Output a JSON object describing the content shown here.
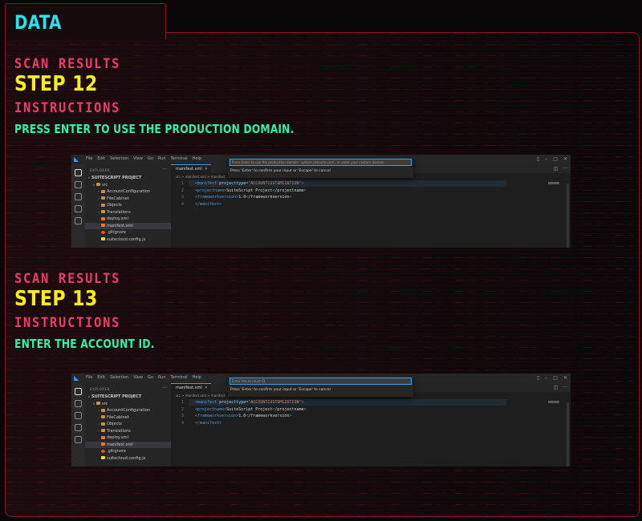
{
  "header": {
    "title": "DATA"
  },
  "steps": [
    {
      "scan_label": "SCAN RESULTS",
      "step": "STEP 12",
      "instructions_label": "INSTRUCTIONS",
      "instruction": "PRESS ENTER TO USE THE PRODUCTION DOMAIN.",
      "screenshot": {
        "menu": [
          "File",
          "Edit",
          "Selection",
          "View",
          "Go",
          "Run",
          "Terminal",
          "Help"
        ],
        "palette_input": "Press Enter to use the production domain 'system.netsuite.com', or enter your custom domain.",
        "palette_hint": "Press 'Enter' to confirm your input or 'Escape' to cancel",
        "explorer_label": "EXPLORER",
        "tree": [
          {
            "label": "SUITESCRIPT PROJECT",
            "kind": "root"
          },
          {
            "label": "src",
            "kind": "folder-open"
          },
          {
            "label": "AccountConfiguration",
            "kind": "folder"
          },
          {
            "label": "FileCabinet",
            "kind": "folder"
          },
          {
            "label": "Objects",
            "kind": "folder"
          },
          {
            "label": "Translations",
            "kind": "folder"
          },
          {
            "label": "deploy.xml",
            "kind": "xml"
          },
          {
            "label": "manifest.xml",
            "kind": "xml",
            "selected": true
          },
          {
            "label": ".gitignore",
            "kind": "git"
          },
          {
            "label": "suitecloud.config.js",
            "kind": "js"
          }
        ],
        "tab_label": "manifest.xml",
        "breadcrumb": "src > manifest.xml > manifest",
        "code_lines": [
          {
            "n": "1",
            "text": "<manifest projecttype=\"ACCOUNTCUSTOMIZATION\">"
          },
          {
            "n": "2",
            "text": "  <projectname>SuiteScript Project</projectname>"
          },
          {
            "n": "3",
            "text": "  <frameworkversion>1.0</frameworkversion>"
          },
          {
            "n": "4",
            "text": "</manifest>"
          }
        ]
      }
    },
    {
      "scan_label": "SCAN RESULTS",
      "step": "STEP 13",
      "instructions_label": "INSTRUCTIONS",
      "instruction": "ENTER THE ACCOUNT ID.",
      "screenshot": {
        "menu": [
          "File",
          "Edit",
          "Selection",
          "View",
          "Go",
          "Run",
          "Terminal",
          "Help"
        ],
        "palette_input": "Enter the account ID.",
        "palette_hint": "Press 'Enter' to confirm your input or 'Escape' to cancel",
        "explorer_label": "EXPLORER",
        "tree": [
          {
            "label": "SUITESCRIPT PROJECT",
            "kind": "root"
          },
          {
            "label": "src",
            "kind": "folder-open"
          },
          {
            "label": "AccountConfiguration",
            "kind": "folder"
          },
          {
            "label": "FileCabinet",
            "kind": "folder"
          },
          {
            "label": "Objects",
            "kind": "folder"
          },
          {
            "label": "Translations",
            "kind": "folder"
          },
          {
            "label": "deploy.xml",
            "kind": "xml"
          },
          {
            "label": "manifest.xml",
            "kind": "xml",
            "selected": true
          },
          {
            "label": ".gitignore",
            "kind": "git"
          },
          {
            "label": "suitecloud.config.js",
            "kind": "js"
          }
        ],
        "tab_label": "manifest.xml",
        "breadcrumb": "src > manifest.xml > manifest",
        "code_lines": [
          {
            "n": "1",
            "text": "<manifest projecttype=\"ACCOUNTCUSTOMIZATION\">"
          },
          {
            "n": "2",
            "text": "  <projectname>SuiteScript Project</projectname>"
          },
          {
            "n": "3",
            "text": "  <frameworkversion>1.0</frameworkversion>"
          },
          {
            "n": "4",
            "text": "</manifest>"
          }
        ]
      }
    }
  ]
}
